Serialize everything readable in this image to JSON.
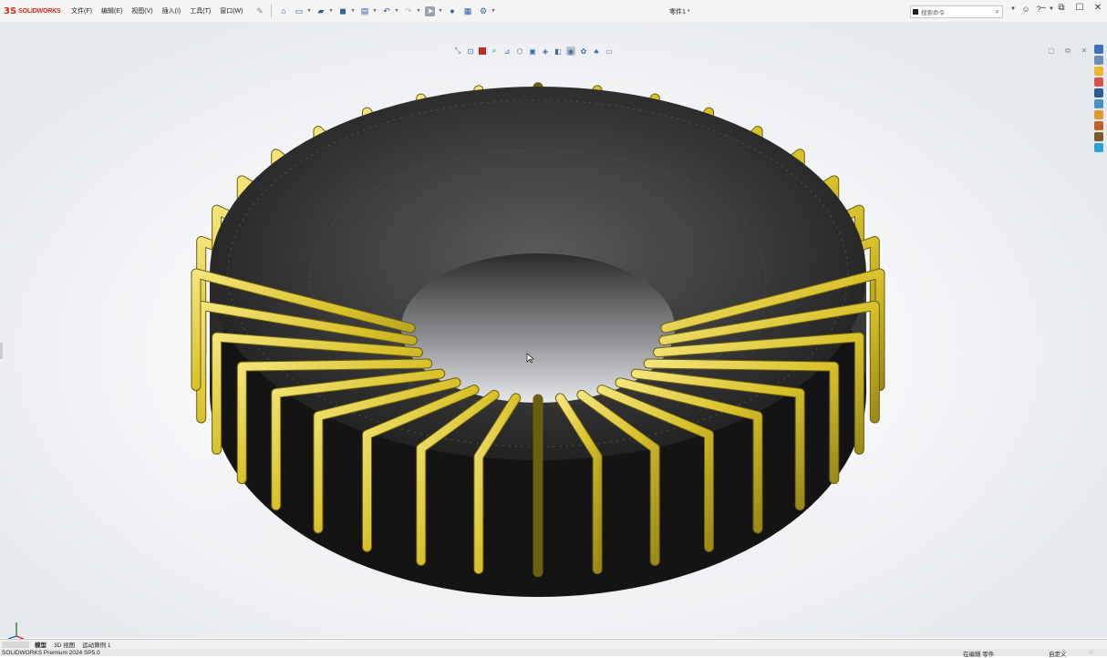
{
  "app": {
    "logo_ds": "3S",
    "logo_text": "SOLIDWORKS"
  },
  "menu": [
    "文件(F)",
    "编辑(E)",
    "视图(V)",
    "插入(I)",
    "工具(T)",
    "窗口(W)"
  ],
  "document": {
    "title": "零件1 *"
  },
  "search": {
    "placeholder": "搜索命令"
  },
  "tabs": [
    "模型",
    "3D 视图",
    "运动算例 1"
  ],
  "status": {
    "left": "SOLIDWORKS Premium 2024 SP5.0",
    "editing": "在编辑 零件",
    "custom": "自定义"
  },
  "colors": {
    "accent": "#d52b1e",
    "core": "#1b1b1b",
    "winding": "#e3cf3a"
  },
  "model": {
    "winding_turns": 36
  }
}
